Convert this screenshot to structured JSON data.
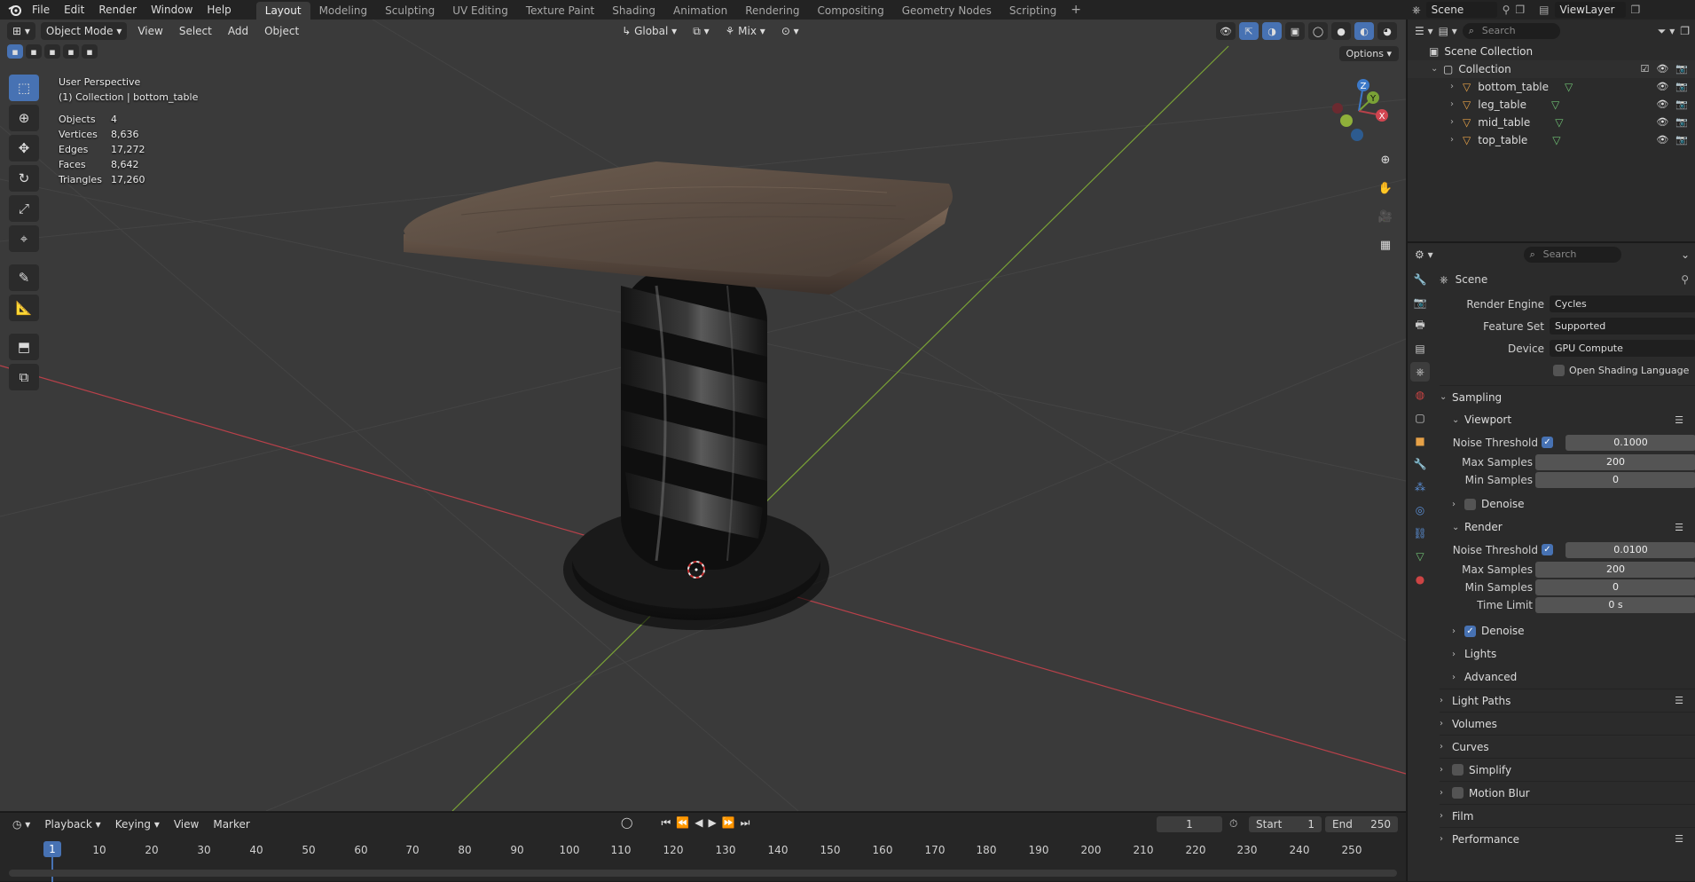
{
  "topbar": {
    "menus": [
      "File",
      "Edit",
      "Render",
      "Window",
      "Help"
    ],
    "workspaces": [
      "Layout",
      "Modeling",
      "Sculpting",
      "UV Editing",
      "Texture Paint",
      "Shading",
      "Animation",
      "Rendering",
      "Compositing",
      "Geometry Nodes",
      "Scripting"
    ],
    "active_workspace": "Layout",
    "add_workspace": "+",
    "scene_name": "Scene",
    "viewlayer_name": "ViewLayer"
  },
  "viewport": {
    "mode": "Object Mode",
    "menus": [
      "View",
      "Select",
      "Add",
      "Object"
    ],
    "orientation": "Global",
    "pivot_mix": "Mix",
    "options_label": "Options",
    "overlay_title": "User Perspective",
    "overlay_subtitle": "(1) Collection | bottom_table",
    "stats": [
      {
        "label": "Objects",
        "value": "4"
      },
      {
        "label": "Vertices",
        "value": "8,636"
      },
      {
        "label": "Edges",
        "value": "17,272"
      },
      {
        "label": "Faces",
        "value": "8,642"
      },
      {
        "label": "Triangles",
        "value": "17,260"
      }
    ],
    "gizmo_axes": {
      "x": "X",
      "y": "Y",
      "z": "Z"
    },
    "colors": {
      "x_axis": "#b8414a",
      "y_axis": "#7aa236",
      "z_axis": "#3c79c8",
      "accent": "#4772b3"
    }
  },
  "timeline": {
    "menus": [
      "Playback",
      "Keying",
      "View",
      "Marker"
    ],
    "current_frame": "1",
    "start_label": "Start",
    "start_value": "1",
    "end_label": "End",
    "end_value": "250",
    "ruler": [
      "10",
      "20",
      "30",
      "40",
      "50",
      "60",
      "70",
      "80",
      "90",
      "100",
      "110",
      "120",
      "130",
      "140",
      "150",
      "160",
      "170",
      "180",
      "190",
      "200",
      "210",
      "220",
      "230",
      "240",
      "250"
    ]
  },
  "outliner": {
    "search_placeholder": "Search",
    "scene_collection": "Scene Collection",
    "collection": "Collection",
    "objects": [
      "bottom_table",
      "leg_table",
      "mid_table",
      "top_table"
    ]
  },
  "properties": {
    "search_placeholder": "Search",
    "context": "Scene",
    "render_engine_label": "Render Engine",
    "render_engine": "Cycles",
    "feature_set_label": "Feature Set",
    "feature_set": "Supported",
    "device_label": "Device",
    "device": "GPU Compute",
    "osl_label": "Open Shading Language",
    "sampling": "Sampling",
    "viewport_sub": "Viewport",
    "render_sub": "Render",
    "noise_threshold_label": "Noise Threshold",
    "max_samples_label": "Max Samples",
    "min_samples_label": "Min Samples",
    "time_limit_label": "Time Limit",
    "vp_noise_threshold": "0.1000",
    "vp_max_samples": "200",
    "vp_min_samples": "0",
    "r_noise_threshold": "0.0100",
    "r_max_samples": "200",
    "r_min_samples": "0",
    "r_time_limit": "0 s",
    "denoise_label": "Denoise",
    "lights_label": "Lights",
    "advanced_label": "Advanced",
    "panels": [
      "Light Paths",
      "Volumes",
      "Curves",
      "Simplify",
      "Motion Blur",
      "Film",
      "Performance"
    ]
  }
}
